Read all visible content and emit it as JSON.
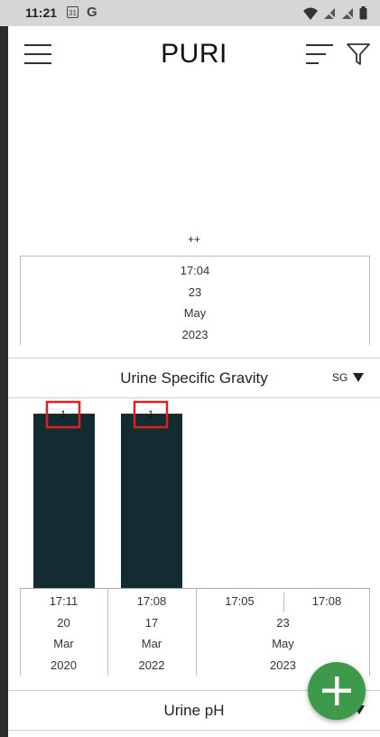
{
  "status_bar": {
    "time": "11:21",
    "calendar_day": "31",
    "g_label": "G"
  },
  "app_bar": {
    "brand": "PURI"
  },
  "section_ketones": {
    "value_label": "++",
    "timestamps": [
      {
        "time": "17:04",
        "day": "23",
        "month": "May",
        "year": "2023"
      }
    ]
  },
  "section_sg": {
    "title": "Urine Specific Gravity",
    "selector_value": "SG",
    "chart_data": {
      "type": "bar",
      "categories": [
        "17:11 20 Mar 2020",
        "17:08 17 Mar 2022",
        "17:05 23 May 2023",
        "17:08 23 May 2023"
      ],
      "values": [
        1,
        1,
        null,
        null
      ],
      "data_labels": [
        "1",
        "1",
        "",
        ""
      ],
      "bar_color": "#132c31",
      "label_box_color": "#e0201c"
    },
    "timestamps": [
      {
        "time": "17:11",
        "day": "20",
        "month": "Mar",
        "year": "2020"
      },
      {
        "time": "17:08",
        "day": "17",
        "month": "Mar",
        "year": "2022"
      }
    ],
    "group_2023": {
      "times": [
        "17:05",
        "17:08"
      ],
      "day": "23",
      "month": "May",
      "year": "2023"
    }
  },
  "section_ph": {
    "title": "Urine pH"
  },
  "colors": {
    "fab": "#3c9a4a",
    "status_bar": "#d6d6d6",
    "bar": "#132c31"
  }
}
